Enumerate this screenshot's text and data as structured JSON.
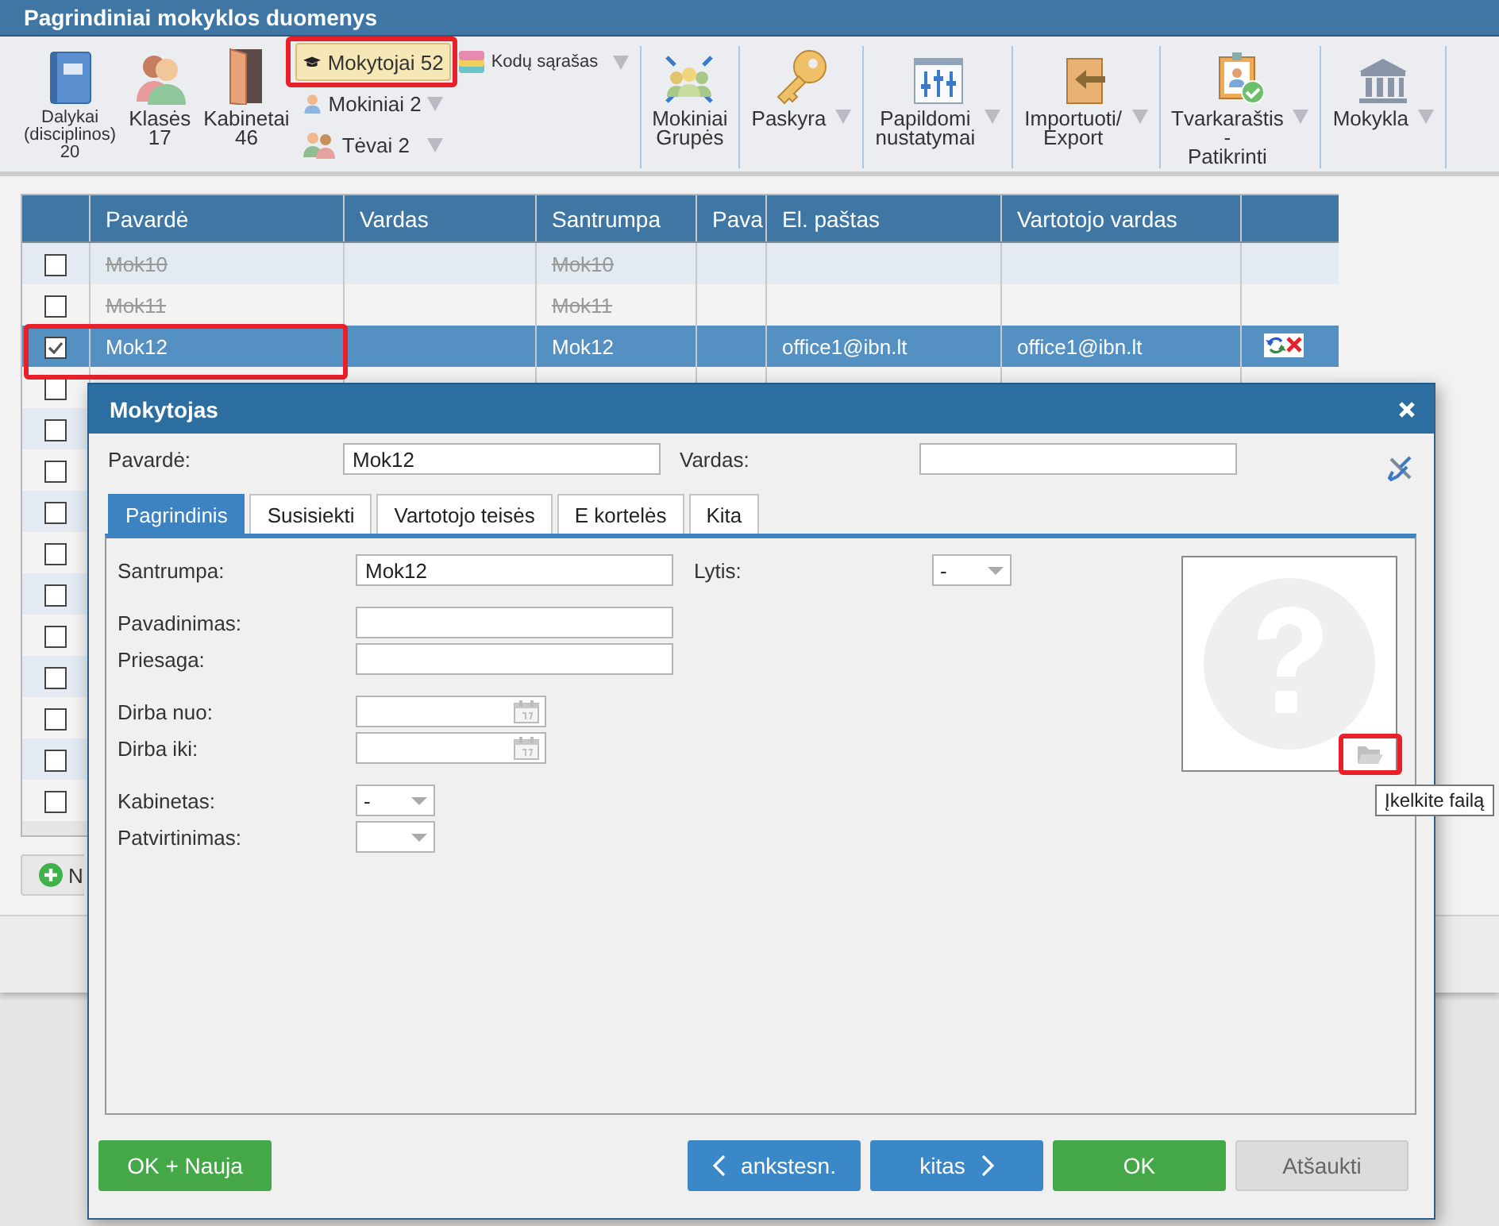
{
  "window": {
    "title": "Pagrindiniai mokyklos duomenys"
  },
  "toolbar": {
    "groups": [
      {
        "items": [
          {
            "kind": "big",
            "label": "Dalykai\n(disciplinos)",
            "count": "20",
            "selected": false,
            "dropdown": false
          },
          {
            "kind": "big",
            "label": "Klasės",
            "count": "17",
            "selected": false,
            "dropdown": false
          },
          {
            "kind": "big",
            "label": "Kabinetai",
            "count": "46",
            "selected": false,
            "dropdown": false
          },
          {
            "kind": "stack",
            "entries": [
              {
                "label": "Mokytojai 52",
                "selected": true,
                "dropdown": false,
                "annotated": true
              },
              {
                "label": "Mokiniai 2",
                "selected": false,
                "dropdown": true,
                "annotated": false
              },
              {
                "label": "Tėvai 2",
                "selected": false,
                "dropdown": true,
                "annotated": false
              }
            ]
          },
          {
            "kind": "small",
            "label": "Kodų sąrašas",
            "selected": false,
            "dropdown": true
          }
        ]
      },
      {
        "items": [
          {
            "kind": "big",
            "label": "Mokiniai\nGrupės",
            "selected": false,
            "dropdown": false
          }
        ]
      },
      {
        "items": [
          {
            "kind": "big",
            "label": "Paskyra",
            "selected": false,
            "dropdown": true
          }
        ]
      },
      {
        "items": [
          {
            "kind": "big",
            "label": "Papildomi\nnustatymai",
            "selected": false,
            "dropdown": true
          }
        ]
      },
      {
        "items": [
          {
            "kind": "big",
            "label": "Importuoti/\nExport",
            "selected": false,
            "dropdown": true
          }
        ]
      },
      {
        "items": [
          {
            "kind": "big",
            "label": "Tvarkaraštis\n-\nPatikrinti",
            "selected": false,
            "dropdown": true
          }
        ]
      },
      {
        "items": [
          {
            "kind": "big",
            "label": "Mokykla",
            "selected": false,
            "dropdown": true
          }
        ]
      }
    ]
  },
  "table": {
    "columns": [
      "Pavardė",
      "Vardas",
      "Santrumpa",
      "Pava",
      "El. paštas",
      "Vartotojo vardas"
    ],
    "rows": [
      {
        "checked": false,
        "selected": false,
        "deleted": true,
        "annotated": false,
        "surname": "Mok10",
        "abbreviation": "Mok10"
      },
      {
        "checked": false,
        "selected": false,
        "deleted": true,
        "annotated": false,
        "surname": "Mok11",
        "abbreviation": "Mok11"
      },
      {
        "checked": true,
        "selected": true,
        "deleted": false,
        "annotated": true,
        "surname": "Mok12",
        "abbreviation": "Mok12",
        "email": "office1@ibn.lt",
        "username": "office1@ibn.lt",
        "actions": true
      },
      {
        "checked": false,
        "selected": false
      },
      {
        "checked": false,
        "selected": false
      },
      {
        "checked": false,
        "selected": false
      },
      {
        "checked": false,
        "selected": false
      },
      {
        "checked": false,
        "selected": false
      },
      {
        "checked": false,
        "selected": false
      },
      {
        "checked": false,
        "selected": false
      },
      {
        "checked": false,
        "selected": false
      },
      {
        "checked": false,
        "selected": false
      },
      {
        "checked": false,
        "selected": false
      },
      {
        "checked": false,
        "selected": false
      }
    ]
  },
  "add_button": {
    "label": "N"
  },
  "dialog": {
    "title": "Mokytojas",
    "fields": [
      {
        "label": "Pavardė:",
        "value": "Mok12"
      },
      {
        "label": "Vardas:"
      }
    ],
    "tabs": [
      {
        "label": "Pagrindinis",
        "selected": true
      },
      {
        "label": "Susisiekti",
        "selected": false
      },
      {
        "label": "Vartotojo teisės",
        "selected": false
      },
      {
        "label": "E kortelės",
        "selected": false
      },
      {
        "label": "Kita",
        "selected": false
      }
    ],
    "form_groups": [
      [
        {
          "kind": "text",
          "label": "Santrumpa:",
          "value": "Mok12",
          "side": {
            "kind": "select",
            "label": "Lytis:",
            "value": "-"
          }
        }
      ],
      [
        {
          "kind": "text",
          "label": "Pavadinimas:"
        },
        {
          "kind": "text",
          "label": "Priesaga:"
        }
      ],
      [
        {
          "kind": "date",
          "label": "Dirba nuo:"
        },
        {
          "kind": "date",
          "label": "Dirba iki:"
        }
      ],
      [
        {
          "kind": "select",
          "label": "Kabinetas:",
          "value": "-"
        },
        {
          "kind": "select",
          "label": "Patvirtinimas:"
        }
      ]
    ],
    "photo": {
      "upload_annotated": true,
      "tooltip": "Įkelkite failą"
    },
    "buttons": [
      {
        "label": "OK + Nauja",
        "kind": "success"
      },
      {
        "label": "ankstesn.",
        "kind": "prev"
      },
      {
        "label": "kitas",
        "kind": "next"
      },
      {
        "label": "OK",
        "kind": "success"
      },
      {
        "label": "Atšaukti",
        "kind": "plain"
      }
    ]
  }
}
